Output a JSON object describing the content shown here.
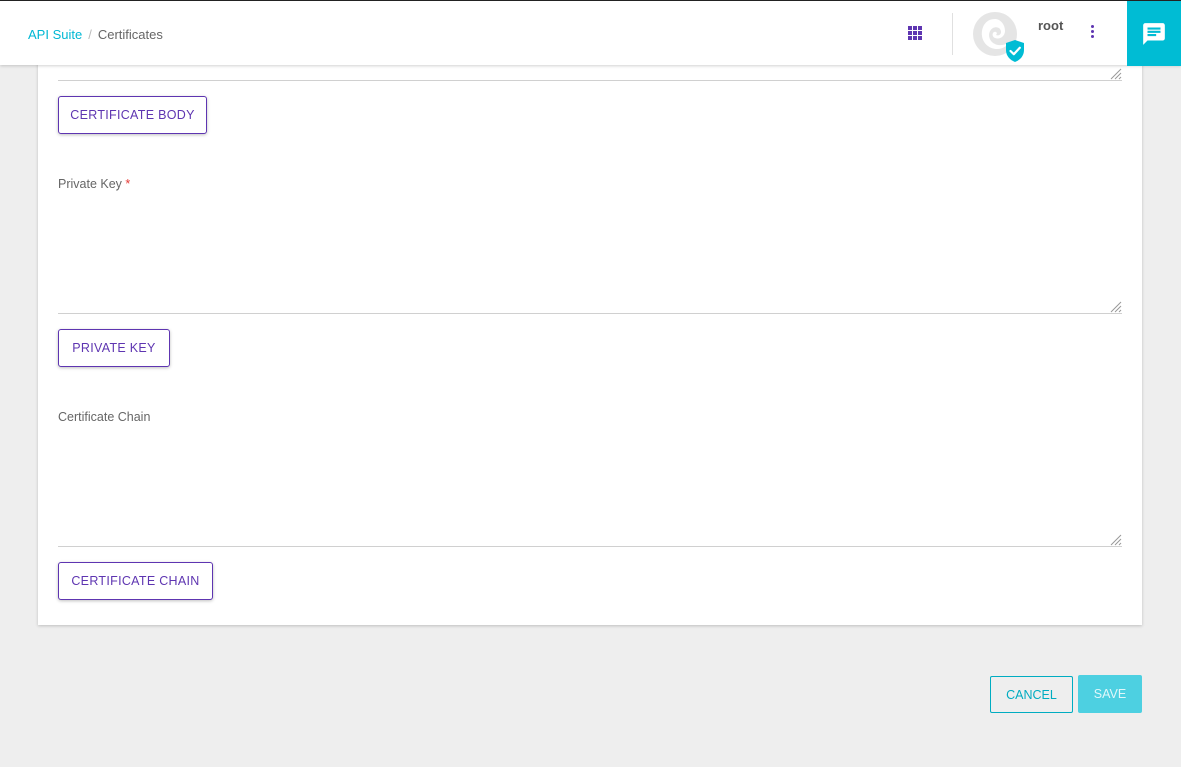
{
  "header": {
    "breadcrumb": {
      "link": "API Suite",
      "separator": "/",
      "current": "Certificates"
    },
    "apps_icon": "apps-grid-icon",
    "user": {
      "name": "root",
      "avatar_icon": "avatar-icon",
      "badge_icon": "verified-shield-icon"
    },
    "menu_icon": "more-vert-icon",
    "chat_icon": "chat-icon"
  },
  "form": {
    "certificate_body_button": "CERTIFICATE BODY",
    "private_key": {
      "label": "Private Key",
      "required_mark": "*",
      "value": "",
      "button": "PRIVATE KEY"
    },
    "certificate_chain": {
      "label": "Certificate Chain",
      "value": "",
      "button": "CERTIFICATE CHAIN"
    }
  },
  "actions": {
    "cancel": "CANCEL",
    "save": "SAVE"
  },
  "colors": {
    "accent": "#00bcd4",
    "primary": "#5e35b1",
    "required": "#e53935"
  }
}
